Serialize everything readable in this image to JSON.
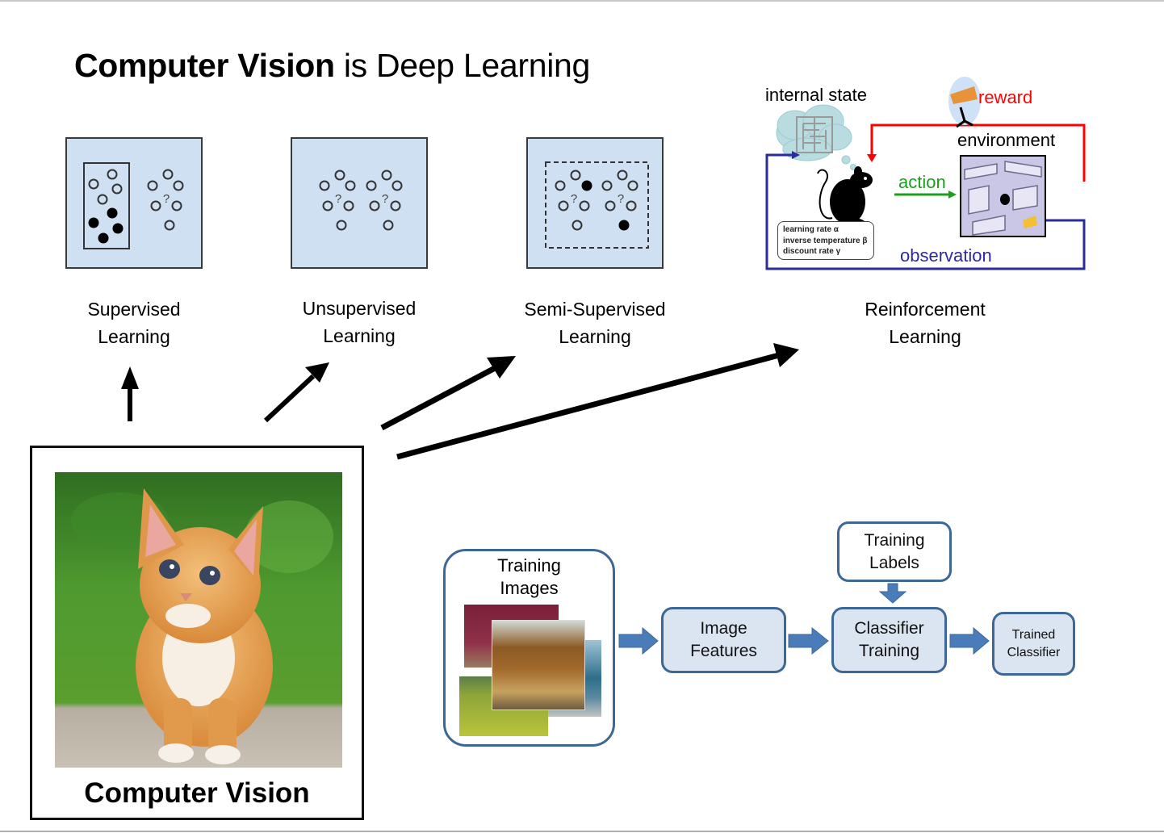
{
  "slide": {
    "title_bold": "Computer Vision",
    "title_rest": " is Deep Learning"
  },
  "paradigms": [
    {
      "line1": "Supervised",
      "line2": "Learning"
    },
    {
      "line1": "Unsupervised",
      "line2": "Learning"
    },
    {
      "line1": "Semi-Supervised",
      "line2": "Learning"
    },
    {
      "line1": "Reinforcement",
      "line2": "Learning"
    }
  ],
  "panel_question_mark": "?",
  "computer_vision": {
    "label": "Computer Vision",
    "image_subject": "orange kitten on grass"
  },
  "reinforcement_diagram": {
    "internal_state": "internal state",
    "reward": "reward",
    "environment": "environment",
    "action": "action",
    "observation": "observation",
    "params": [
      "learning rate α",
      "inverse temperature β",
      "discount rate γ"
    ],
    "colors": {
      "reward": "#ff0000",
      "action": "#1aa01a",
      "observation": "#2b2b9e"
    }
  },
  "pipeline": {
    "training_images": {
      "line1": "Training",
      "line2": "Images"
    },
    "image_features": {
      "line1": "Image",
      "line2": "Features"
    },
    "training_labels": {
      "line1": "Training",
      "line2": "Labels"
    },
    "classifier_training": {
      "line1": "Classifier",
      "line2": "Training"
    },
    "trained_classifier": {
      "line1": "Trained",
      "line2": "Classifier"
    },
    "colors": {
      "border": "#3d6896",
      "fill": "#dbe5f1",
      "arrow": "#4a7cba"
    }
  },
  "colors": {
    "panel_bg": "#cfe0f2"
  }
}
